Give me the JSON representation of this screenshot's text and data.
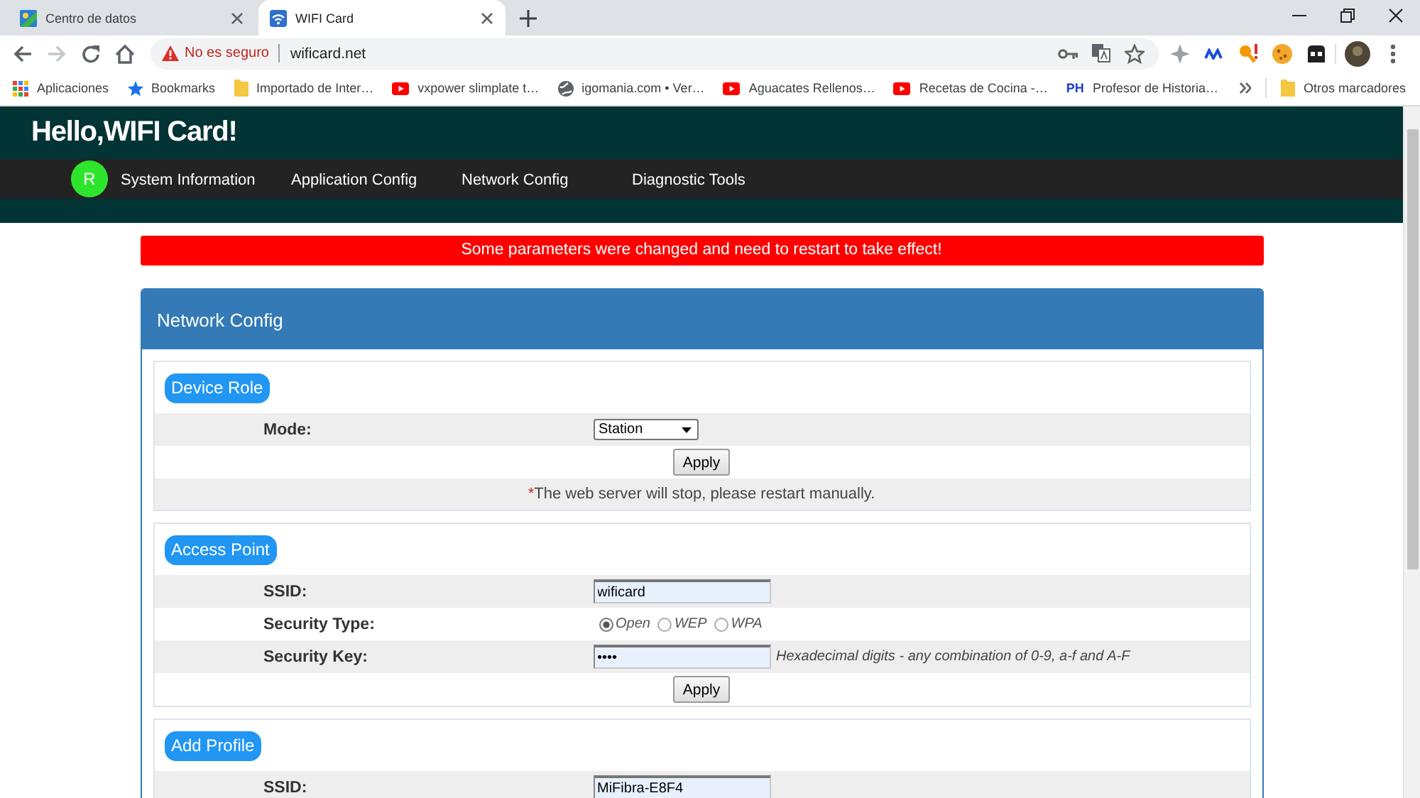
{
  "browser": {
    "tabs": [
      {
        "kind": "tile",
        "title": "Centro de datos",
        "selected": false
      },
      {
        "kind": "wifi",
        "title": "WIFI Card",
        "selected": true
      }
    ],
    "address": {
      "security": "No es seguro",
      "url": "wificard.net"
    },
    "bookmarks": [
      {
        "kind": "apps",
        "label": "Aplicaciones"
      },
      {
        "kind": "star",
        "label": "Bookmarks"
      },
      {
        "kind": "folder",
        "label": "Importado de Inter…"
      },
      {
        "kind": "video",
        "label": "vxpower slimplate t…"
      },
      {
        "kind": "globe",
        "label": "igomania.com • Ver…"
      },
      {
        "kind": "video",
        "label": "Aguacates Rellenos…"
      },
      {
        "kind": "video",
        "label": "Recetas de Cocina -…"
      },
      {
        "kind": "monogram",
        "mark": "PH",
        "label": "Profesor de Historia…"
      }
    ],
    "other_bookmarks": {
      "kind": "folder",
      "label": "Otros marcadores"
    }
  },
  "page": {
    "title": "Hello,WIFI Card!",
    "avatar": "R",
    "nav": [
      "System Information",
      "Application Config",
      "Network Config",
      "Diagnostic Tools"
    ],
    "alert": "Some parameters were changed and need to restart to take effect!",
    "panel": {
      "title": "Network Config",
      "sections": [
        {
          "title": "Device Role",
          "rows": [
            {
              "kind": "select",
              "label": "Mode:",
              "value": "Station"
            },
            {
              "kind": "button",
              "label": "Apply"
            },
            {
              "kind": "note",
              "marker": "*",
              "text": "The web server will stop, please restart manually."
            }
          ]
        },
        {
          "title": "Access Point",
          "rows": [
            {
              "kind": "text",
              "label": "SSID:",
              "value": "wificard"
            },
            {
              "kind": "radio",
              "label": "Security Type:",
              "options": [
                {
                  "label": "Open",
                  "selected": true
                },
                {
                  "label": "WEP",
                  "selected": false
                },
                {
                  "label": "WPA",
                  "selected": false
                }
              ]
            },
            {
              "kind": "password",
              "label": "Security Key:",
              "value": "••••",
              "hint": "Hexadecimal digits - any combination of 0-9, a-f and A-F"
            },
            {
              "kind": "button",
              "label": "Apply"
            }
          ]
        },
        {
          "title": "Add Profile",
          "rows": [
            {
              "kind": "text",
              "label": "SSID:",
              "value": "MiFibra-E8F4"
            }
          ]
        }
      ]
    }
  }
}
